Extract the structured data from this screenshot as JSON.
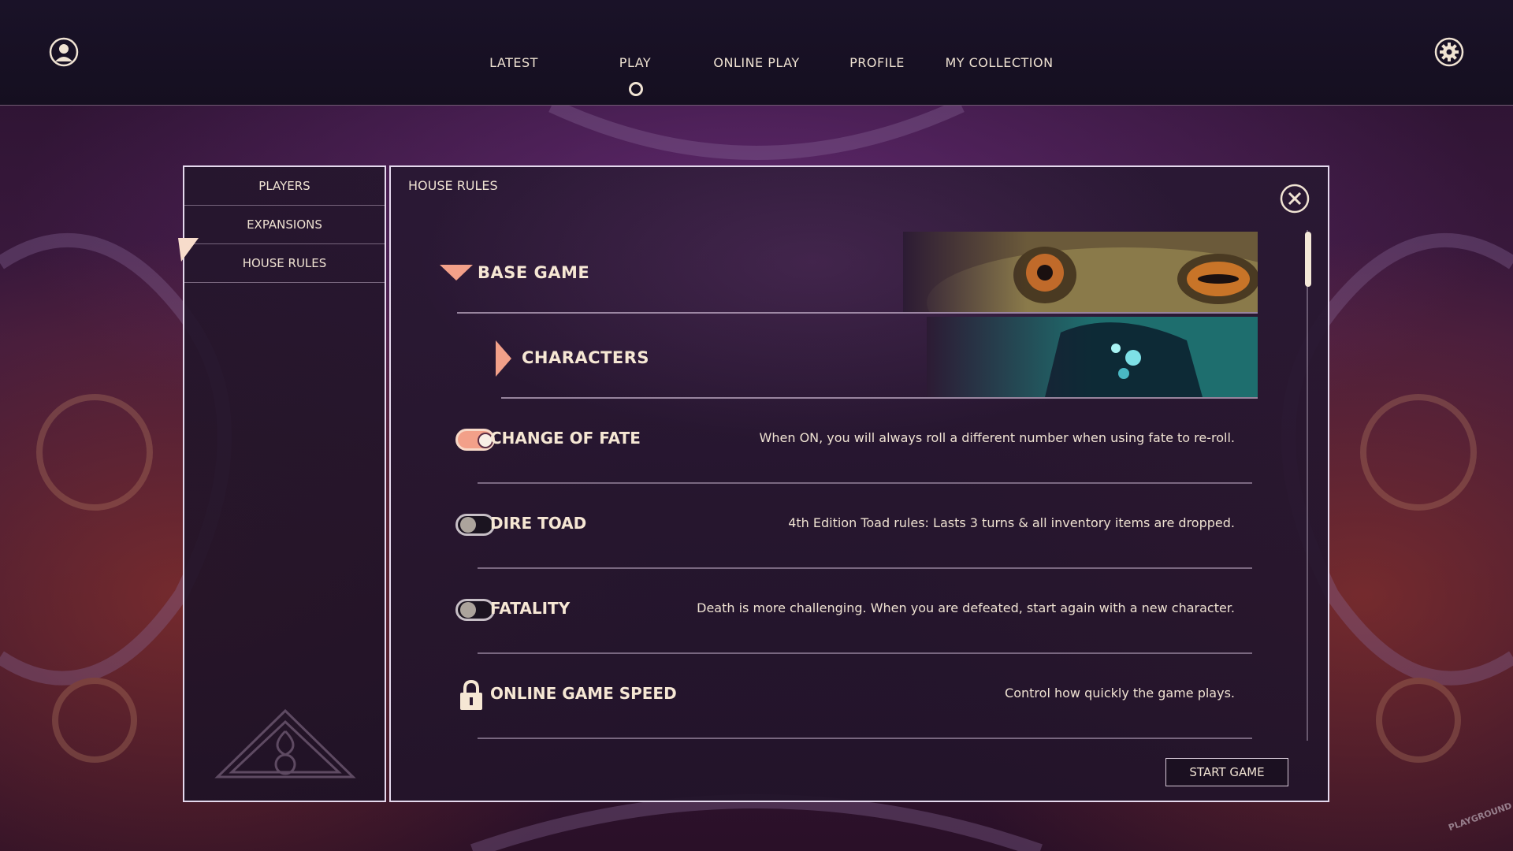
{
  "nav": {
    "items": [
      "LATEST",
      "PLAY",
      "ONLINE PLAY",
      "PROFILE",
      "MY COLLECTION"
    ],
    "active": "PLAY"
  },
  "sidebar": {
    "items": [
      {
        "label": "PLAYERS"
      },
      {
        "label": "EXPANSIONS"
      },
      {
        "label": "HOUSE RULES",
        "selected": true
      }
    ]
  },
  "main": {
    "title": "HOUSE RULES",
    "sections": {
      "base_game": "BASE GAME",
      "characters": "CHARACTERS"
    },
    "rules": [
      {
        "name": "CHANGE OF FATE",
        "desc": "When ON, you will always roll a different number when using fate to re-roll.",
        "state": "on"
      },
      {
        "name": "DIRE TOAD",
        "desc": "4th Edition Toad rules: Lasts 3 turns & all inventory items are dropped.",
        "state": "off"
      },
      {
        "name": "FATALITY",
        "desc": "Death is more challenging. When you are defeated, start again with a new character.",
        "state": "off"
      },
      {
        "name": "ONLINE GAME SPEED",
        "desc": "Control how quickly the game plays.",
        "state": "locked"
      }
    ],
    "start_button": "START GAME"
  },
  "watermark": "PLAYGROUND",
  "colors": {
    "accent": "#f2a089",
    "panel_border": "#e5d9ee",
    "text": "#efe2d2"
  },
  "icons": [
    "profile-icon",
    "settings-gear-icon",
    "close-icon",
    "expanded-triangle-icon",
    "collapsed-triangle-icon",
    "lock-icon",
    "emblem-logo"
  ]
}
